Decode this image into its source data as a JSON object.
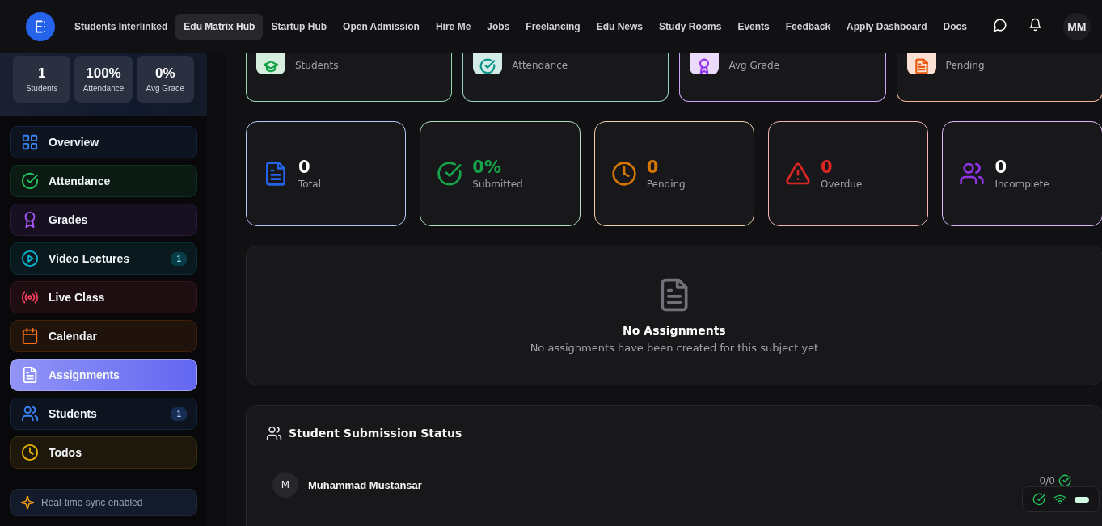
{
  "header": {
    "nav": [
      {
        "label": "Students Interlinked",
        "selected": false
      },
      {
        "label": "Edu Matrix Hub",
        "selected": true
      },
      {
        "label": "Startup Hub",
        "selected": false
      },
      {
        "label": "Open Admission",
        "selected": false
      },
      {
        "label": "Hire Me",
        "selected": false
      },
      {
        "label": "Jobs",
        "selected": false
      },
      {
        "label": "Freelancing",
        "selected": false
      },
      {
        "label": "Edu News",
        "selected": false
      },
      {
        "label": "Study Rooms",
        "selected": false
      },
      {
        "label": "Events",
        "selected": false
      },
      {
        "label": "Feedback",
        "selected": false
      },
      {
        "label": "Apply Dashboard",
        "selected": false
      },
      {
        "label": "Docs",
        "selected": false
      }
    ],
    "avatar": "MM"
  },
  "sidebar": {
    "stats": [
      {
        "value": "1",
        "label": "Students"
      },
      {
        "value": "100%",
        "label": "Attendance"
      },
      {
        "value": "0%",
        "label": "Avg Grade"
      }
    ],
    "items": [
      {
        "label": "Overview",
        "color": "#3b82f6",
        "selected": false
      },
      {
        "label": "Attendance",
        "color": "#22c55e",
        "selected": false
      },
      {
        "label": "Grades",
        "color": "#a855f7",
        "selected": false
      },
      {
        "label": "Video Lectures",
        "color": "#06b6d4",
        "selected": false,
        "badge": "1"
      },
      {
        "label": "Live Class",
        "color": "#f43f5e",
        "selected": false
      },
      {
        "label": "Calendar",
        "color": "#f97316",
        "selected": false
      },
      {
        "label": "Assignments",
        "color": "#6366f1",
        "selected": true
      },
      {
        "label": "Students",
        "color": "#3b82f6",
        "selected": false,
        "badge": "1"
      },
      {
        "label": "Todos",
        "color": "#eab308",
        "selected": false
      }
    ],
    "footer": "Real-time sync enabled"
  },
  "summary_cards": [
    {
      "label": "Students",
      "color": "#16a34a"
    },
    {
      "label": "Attendance",
      "color": "#0d9488"
    },
    {
      "label": "Avg Grade",
      "color": "#9333ea"
    },
    {
      "label": "Pending",
      "color": "#ea580c"
    }
  ],
  "assignment_stats": [
    {
      "value": "0",
      "label": "Total",
      "color": "#2563eb"
    },
    {
      "value": "0%",
      "label": "Submitted",
      "color": "#16a34a"
    },
    {
      "value": "0",
      "label": "Pending",
      "color": "#d97706"
    },
    {
      "value": "0",
      "label": "Overdue",
      "color": "#dc2626"
    },
    {
      "value": "0",
      "label": "Incomplete",
      "color": "#9333ea"
    }
  ],
  "empty_state": {
    "title": "No Assignments",
    "message": "No assignments have been created for this subject yet"
  },
  "submission_status": {
    "title": "Student Submission Status",
    "students": [
      {
        "initial": "M",
        "name": "Muhammad Mustansar",
        "score": "0/0"
      }
    ]
  }
}
